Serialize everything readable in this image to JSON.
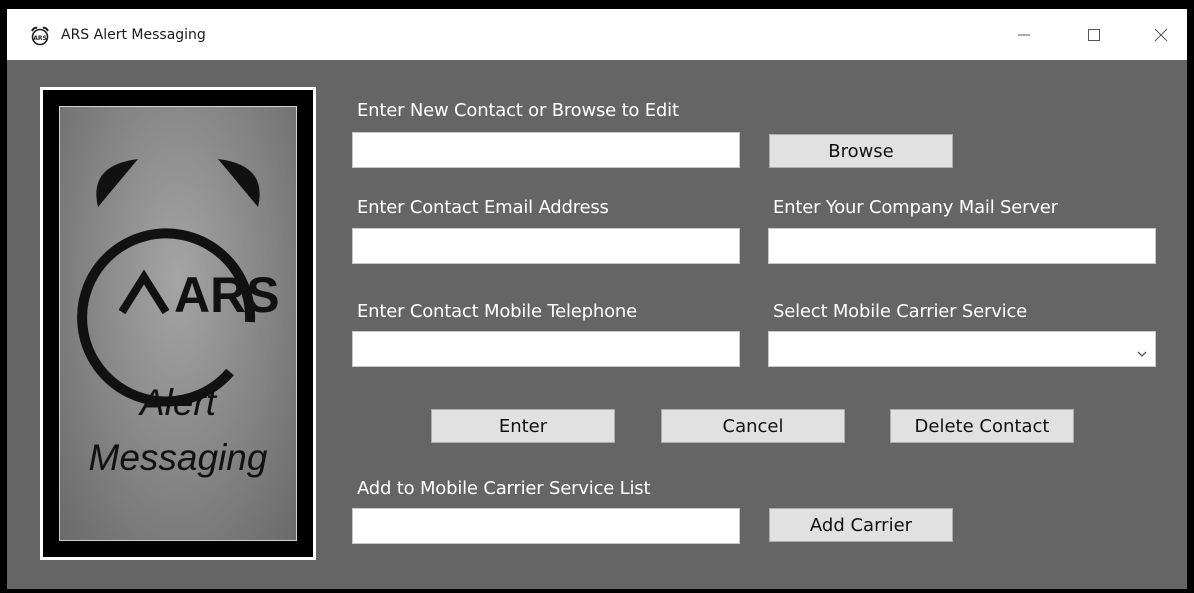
{
  "window": {
    "title": "ARS Alert Messaging",
    "minimize_icon": "minimize-icon",
    "maximize_icon": "maximize-icon",
    "close_icon": "close-icon"
  },
  "logo": {
    "brand": "ARS",
    "line1": "Alert",
    "line2": "Messaging",
    "icon": "alarm-clock-icon"
  },
  "form": {
    "new_contact_label": "Enter New Contact or Browse to Edit",
    "new_contact_value": "",
    "browse_button": "Browse",
    "email_label": "Enter Contact Email Address",
    "email_value": "",
    "mail_server_label": "Enter Your Company Mail Server",
    "mail_server_value": "",
    "mobile_label": "Enter Contact Mobile Telephone",
    "mobile_value": "",
    "carrier_label": "Select Mobile Carrier Service",
    "carrier_value": "",
    "enter_button": "Enter",
    "cancel_button": "Cancel",
    "delete_button": "Delete Contact",
    "add_carrier_label": "Add to Mobile Carrier Service List",
    "add_carrier_value": "",
    "add_carrier_button": "Add Carrier"
  },
  "colors": {
    "window_bg": "#656565",
    "button_bg": "#e1e1e1",
    "label_text": "#ffffff"
  }
}
